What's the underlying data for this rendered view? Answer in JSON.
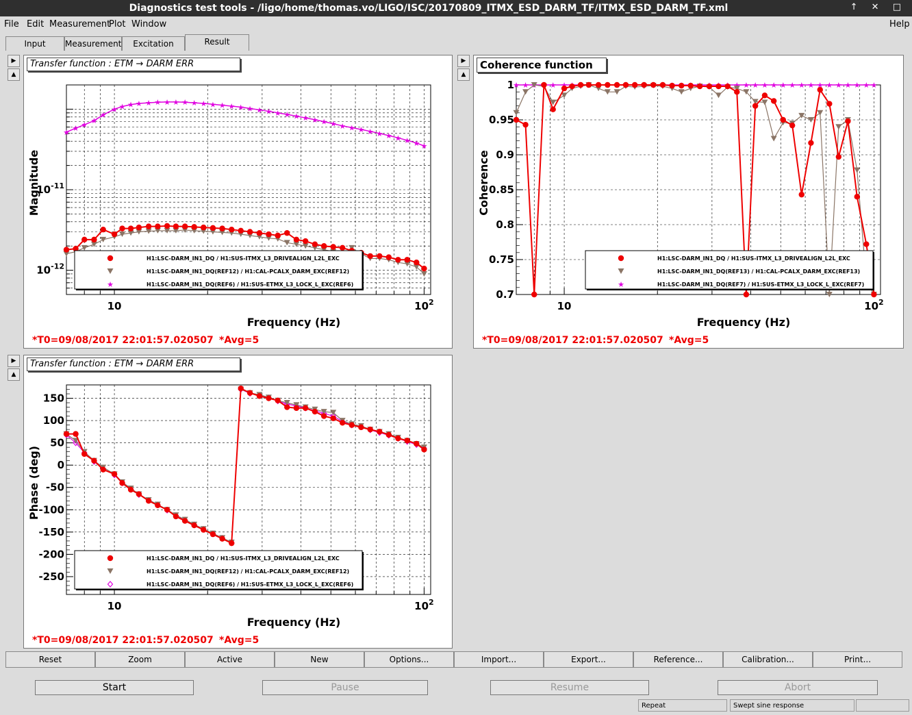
{
  "window": {
    "title": "Diagnostics test tools - /ligo/home/thomas.vo/LIGO/ISC/20170809_ITMX_ESD_DARM_TF/ITMX_ESD_DARM_TF.xml",
    "controls": "↑ ✕ □"
  },
  "menu": {
    "file": "File",
    "edit": "Edit",
    "measurement": "Measurement",
    "plot": "Plot",
    "window": "Window",
    "help": "Help"
  },
  "tabs": [
    {
      "label": "Input"
    },
    {
      "label": "Measurement"
    },
    {
      "label": "Excitation"
    },
    {
      "label": "Result"
    }
  ],
  "panels": {
    "magnitude": {
      "title": "Transfer function : ETM → DARM ERR",
      "t0": "*T0=09/08/2017 22:01:57.020507",
      "avg": "*Avg=5"
    },
    "coherence": {
      "title": "Coherence function",
      "t0": "*T0=09/08/2017 22:01:57.020507",
      "avg": "*Avg=5"
    },
    "phase": {
      "title": "Transfer function : ETM → DARM ERR",
      "t0": "*T0=09/08/2017 22:01:57.020507",
      "avg": "*Avg=5"
    }
  },
  "toolbar": [
    "Reset",
    "Zoom",
    "Active",
    "New",
    "Options...",
    "Import...",
    "Export...",
    "Reference...",
    "Calibration...",
    "Print..."
  ],
  "controls": {
    "start": "Start",
    "pause": "Pause",
    "resume": "Resume",
    "abort": "Abort"
  },
  "status": {
    "mode": "Repeat",
    "type": "Swept sine response"
  },
  "colors": {
    "red": "#ee0000",
    "brown": "#8b7566",
    "magenta": "#e000e0"
  },
  "chart_data": [
    {
      "type": "line",
      "id": "magnitude",
      "title": "Transfer function : ETM → DARM ERR",
      "xlabel": "Frequency (Hz)",
      "ylabel": "Magnitude",
      "xscale": "log",
      "yscale": "log",
      "xlim": [
        7,
        105
      ],
      "ylim": [
        5e-13,
        2e-10
      ],
      "xticks": [
        {
          "v": 10,
          "t": "10"
        },
        {
          "v": 100,
          "t": "10^2"
        }
      ],
      "yticks": [
        {
          "v": 1e-12,
          "t": "10^-12"
        },
        {
          "v": 1e-11,
          "t": "10^-11"
        }
      ],
      "legend_position": "bottom-center",
      "x": [
        7,
        7.5,
        8,
        8.6,
        9.2,
        10,
        10.6,
        11.3,
        12,
        12.9,
        13.8,
        14.8,
        15.8,
        16.9,
        18.1,
        19.4,
        20.8,
        22.3,
        23.9,
        25.6,
        27.4,
        29.4,
        31.5,
        33.7,
        36.1,
        38.7,
        41.4,
        44.4,
        47.5,
        50.9,
        54.5,
        58.4,
        62.6,
        67,
        71.8,
        76.9,
        82.4,
        88.2,
        94.5,
        100
      ],
      "series": [
        {
          "name": "H1:LSC-DARM_IN1_DQ / H1:SUS-ITMX_L3_DRIVEALIGN_L2L_EXC",
          "color": "#ee0000",
          "marker": "circle",
          "values": [
            1.8e-12,
            1.85e-12,
            2.4e-12,
            2.4e-12,
            3.2e-12,
            2.8e-12,
            3.3e-12,
            3.3e-12,
            3.4e-12,
            3.5e-12,
            3.5e-12,
            3.55e-12,
            3.5e-12,
            3.5e-12,
            3.45e-12,
            3.4e-12,
            3.35e-12,
            3.3e-12,
            3.2e-12,
            3.1e-12,
            3e-12,
            2.9e-12,
            2.8e-12,
            2.7e-12,
            2.9e-12,
            2.4e-12,
            2.3e-12,
            2.1e-12,
            2e-12,
            1.95e-12,
            1.9e-12,
            1.75e-12,
            1.65e-12,
            1.5e-12,
            1.5e-12,
            1.45e-12,
            1.35e-12,
            1.35e-12,
            1.25e-12,
            1.05e-12
          ]
        },
        {
          "name": "H1:LSC-DARM_IN1_DQ(REF12) / H1:CAL-PCALX_DARM_EXC(REF12)",
          "color": "#8b7566",
          "marker": "triangle-down",
          "values": [
            1.6e-12,
            1.7e-12,
            1.9e-12,
            2.1e-12,
            2.4e-12,
            2.6e-12,
            2.8e-12,
            2.9e-12,
            3e-12,
            3.05e-12,
            3.1e-12,
            3.1e-12,
            3.1e-12,
            3.15e-12,
            3.1e-12,
            3.05e-12,
            3e-12,
            2.95e-12,
            2.9e-12,
            2.8e-12,
            2.7e-12,
            2.6e-12,
            2.5e-12,
            2.45e-12,
            2.2e-12,
            2.1e-12,
            2e-12,
            1.9e-12,
            1.8e-12,
            1.7e-12,
            1.5e-12,
            1.9e-12,
            1.6e-12,
            1.4e-12,
            1.4e-12,
            1.35e-12,
            1.25e-12,
            1.2e-12,
            1.1e-12,
            9e-13
          ]
        },
        {
          "name": "H1:LSC-DARM_IN1_DQ(REF6) / H1:SUS-ETMX_L3_LOCK_L_EXC(REF6)",
          "color": "#e000e0",
          "marker": "star",
          "values": [
            5.2e-11,
            5.8e-11,
            6.4e-11,
            7.2e-11,
            8.5e-11,
            1e-10,
            1.08e-10,
            1.14e-10,
            1.18e-10,
            1.2e-10,
            1.22e-10,
            1.23e-10,
            1.23e-10,
            1.22e-10,
            1.2e-10,
            1.18e-10,
            1.15e-10,
            1.12e-10,
            1.09e-10,
            1.06e-10,
            1.02e-10,
            9.8e-11,
            9.4e-11,
            9e-11,
            8.6e-11,
            8.2e-11,
            7.8e-11,
            7.4e-11,
            7e-11,
            6.6e-11,
            6.2e-11,
            5.9e-11,
            5.6e-11,
            5.3e-11,
            5e-11,
            4.7e-11,
            4.4e-11,
            4.1e-11,
            3.8e-11,
            3.5e-11
          ]
        }
      ]
    },
    {
      "type": "line",
      "id": "coherence",
      "title": "Coherence function",
      "xlabel": "Frequency (Hz)",
      "ylabel": "Coherence",
      "xscale": "log",
      "yscale": "linear",
      "xlim": [
        7,
        105
      ],
      "ylim": [
        0.7,
        1.0
      ],
      "xticks": [
        {
          "v": 10,
          "t": "10"
        },
        {
          "v": 100,
          "t": "10^2"
        }
      ],
      "yticks": [
        {
          "v": 0.7,
          "t": "0.7"
        },
        {
          "v": 0.75,
          "t": "0.75"
        },
        {
          "v": 0.8,
          "t": "0.8"
        },
        {
          "v": 0.85,
          "t": "0.85"
        },
        {
          "v": 0.9,
          "t": "0.9"
        },
        {
          "v": 0.95,
          "t": "0.95"
        },
        {
          "v": 1,
          "t": "1"
        }
      ],
      "legend_position": "bottom-right",
      "x": [
        7,
        7.5,
        8,
        8.6,
        9.2,
        10,
        10.6,
        11.3,
        12,
        12.9,
        13.8,
        14.8,
        15.8,
        16.9,
        18.1,
        19.4,
        20.8,
        22.3,
        23.9,
        25.6,
        27.4,
        29.4,
        31.5,
        33.7,
        36.1,
        38.7,
        41.4,
        44.4,
        47.5,
        50.9,
        54.5,
        58.4,
        62.6,
        67,
        71.8,
        76.9,
        82.4,
        88.2,
        94.5,
        100
      ],
      "series": [
        {
          "name": "H1:LSC-DARM_IN1_DQ / H1:SUS-ITMX_L3_DRIVEALIGN_L2L_EXC",
          "color": "#ee0000",
          "marker": "circle",
          "values": [
            0.95,
            0.943,
            0.697,
            1.0,
            0.965,
            0.995,
            0.998,
            1.0,
            1.0,
            1.0,
            1.0,
            1.0,
            1.0,
            1.0,
            1.0,
            1.0,
            1.0,
            0.999,
            0.999,
            0.999,
            0.998,
            0.998,
            0.998,
            0.998,
            0.99,
            0.68,
            0.97,
            0.985,
            0.977,
            0.95,
            0.942,
            0.843,
            0.917,
            0.993,
            0.973,
            0.897,
            0.948,
            0.84,
            0.772,
            0.7
          ]
        },
        {
          "name": "H1:LSC-DARM_IN1_DQ(REF13) / H1:CAL-PCALX_DARM_EXC(REF13)",
          "color": "#8b7566",
          "marker": "triangle-down",
          "values": [
            0.96,
            0.99,
            1.0,
            0.998,
            0.975,
            0.985,
            0.995,
            0.998,
            1.0,
            0.995,
            0.99,
            0.99,
            0.998,
            0.997,
            0.998,
            0.999,
            0.998,
            0.995,
            0.99,
            0.995,
            0.998,
            0.997,
            0.985,
            0.997,
            0.995,
            0.99,
            0.976,
            0.975,
            0.923,
            0.946,
            0.945,
            0.956,
            0.95,
            0.96,
            0.55,
            0.94,
            0.95,
            0.878,
            0.72,
            0.7
          ]
        },
        {
          "name": "H1:LSC-DARM_IN1_DQ(REF7) / H1:SUS-ETMX_L3_LOCK_L_EXC(REF7)",
          "color": "#e000e0",
          "marker": "star",
          "values": [
            1,
            1,
            1,
            1,
            1,
            1,
            1,
            1,
            1,
            1,
            1,
            1,
            1,
            1,
            1,
            1,
            1,
            1,
            1,
            1,
            1,
            1,
            1,
            1,
            1,
            1,
            1,
            1,
            1,
            1,
            1,
            1,
            1,
            1,
            1,
            1,
            1,
            1,
            1,
            1
          ]
        }
      ]
    },
    {
      "type": "line",
      "id": "phase",
      "title": "Transfer function : ETM → DARM ERR",
      "xlabel": "Frequency (Hz)",
      "ylabel": "Phase (deg)",
      "xscale": "log",
      "yscale": "linear",
      "xlim": [
        7,
        105
      ],
      "ylim": [
        -290,
        180
      ],
      "xticks": [
        {
          "v": 10,
          "t": "10"
        },
        {
          "v": 100,
          "t": "10^2"
        }
      ],
      "yticks": [
        {
          "v": 150,
          "t": "150"
        },
        {
          "v": 100,
          "t": "100"
        },
        {
          "v": 50,
          "t": "50"
        },
        {
          "v": 0,
          "t": "0"
        },
        {
          "v": -50,
          "t": "-50"
        },
        {
          "v": -100,
          "t": "-100"
        },
        {
          "v": -150,
          "t": "-150"
        },
        {
          "v": -200,
          "t": "-200"
        },
        {
          "v": -250,
          "t": "-250"
        }
      ],
      "legend_position": "bottom-center",
      "x": [
        7,
        7.5,
        8,
        8.6,
        9.2,
        10,
        10.6,
        11.3,
        12,
        12.9,
        13.8,
        14.8,
        15.8,
        16.9,
        18.1,
        19.4,
        20.8,
        22.3,
        23.9,
        25.6,
        27.4,
        29.4,
        31.5,
        33.7,
        36.1,
        38.7,
        41.4,
        44.4,
        47.5,
        50.9,
        54.5,
        58.4,
        62.6,
        67,
        71.8,
        76.9,
        82.4,
        88.2,
        94.5,
        100
      ],
      "series": [
        {
          "name": "H1:LSC-DARM_IN1_DQ / H1:SUS-ITMX_L3_DRIVEALIGN_L2L_EXC",
          "color": "#ee0000",
          "marker": "circle",
          "values": [
            70,
            70,
            25,
            10,
            -10,
            -20,
            -40,
            -55,
            -65,
            -80,
            -90,
            -100,
            -115,
            -125,
            -135,
            -145,
            -155,
            -165,
            -175,
            172,
            162,
            155,
            150,
            145,
            130,
            128,
            128,
            120,
            110,
            105,
            95,
            90,
            85,
            80,
            75,
            68,
            60,
            55,
            48,
            35
          ]
        },
        {
          "name": "H1:LSC-DARM_IN1_DQ(REF12) / H1:CAL-PCALX_DARM_EXC(REF12)",
          "color": "#8b7566",
          "marker": "triangle-down",
          "values": [
            70,
            55,
            30,
            10,
            -5,
            -20,
            -38,
            -52,
            -65,
            -78,
            -88,
            -100,
            -112,
            -122,
            -133,
            -143,
            -153,
            -163,
            -173,
            170,
            162,
            158,
            152,
            145,
            140,
            135,
            130,
            125,
            120,
            118,
            100,
            92,
            88,
            80,
            75,
            70,
            62,
            55,
            48,
            40
          ]
        },
        {
          "name": "H1:LSC-DARM_IN1_DQ(REF6) / H1:SUS-ETMX_L3_LOCK_L_EXC(REF6)",
          "color": "#e000e0",
          "marker": "diamond-open",
          "values": [
            68,
            50,
            28,
            8,
            -8,
            -22,
            -40,
            -54,
            -66,
            -79,
            -89,
            -101,
            -113,
            -123,
            -134,
            -144,
            -154,
            -164,
            -174,
            170,
            161,
            156,
            151,
            144,
            137,
            133,
            128,
            122,
            116,
            110,
            98,
            90,
            86,
            79,
            73,
            67,
            60,
            53,
            46,
            38
          ]
        }
      ]
    }
  ]
}
